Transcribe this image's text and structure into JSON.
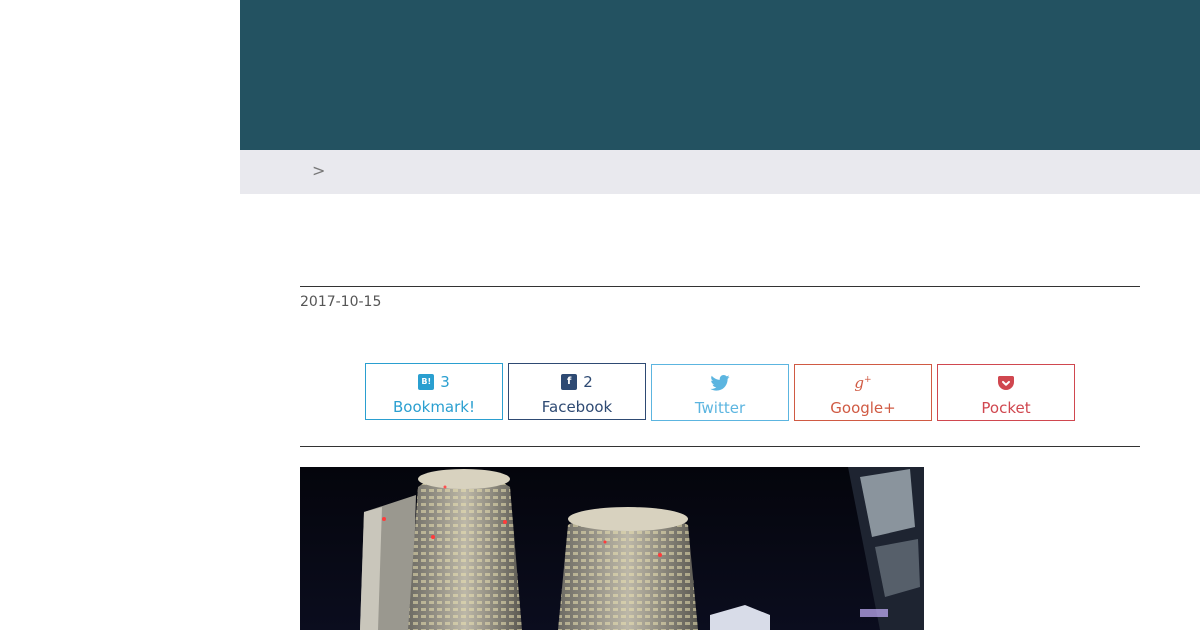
{
  "breadcrumb": {
    "separator": ">"
  },
  "post": {
    "date": "2017-10-15"
  },
  "share": {
    "hatena": {
      "count": "3",
      "label": "Bookmark!",
      "icon": "hatena-bookmark-icon"
    },
    "facebook": {
      "count": "2",
      "label": "Facebook",
      "icon": "facebook-icon"
    },
    "twitter": {
      "label": "Twitter",
      "icon": "twitter-bird-icon"
    },
    "gplus": {
      "label": "Google+",
      "icon": "google-plus-icon"
    },
    "pocket": {
      "label": "Pocket",
      "icon": "pocket-icon"
    }
  },
  "colors": {
    "header": "#235261",
    "breadcrumb_bg": "#e9e9ee",
    "hatena": "#2a9fd0",
    "facebook": "#2e4a73",
    "twitter": "#5cb5e0",
    "gplus": "#d05a43",
    "pocket": "#d0474f"
  }
}
